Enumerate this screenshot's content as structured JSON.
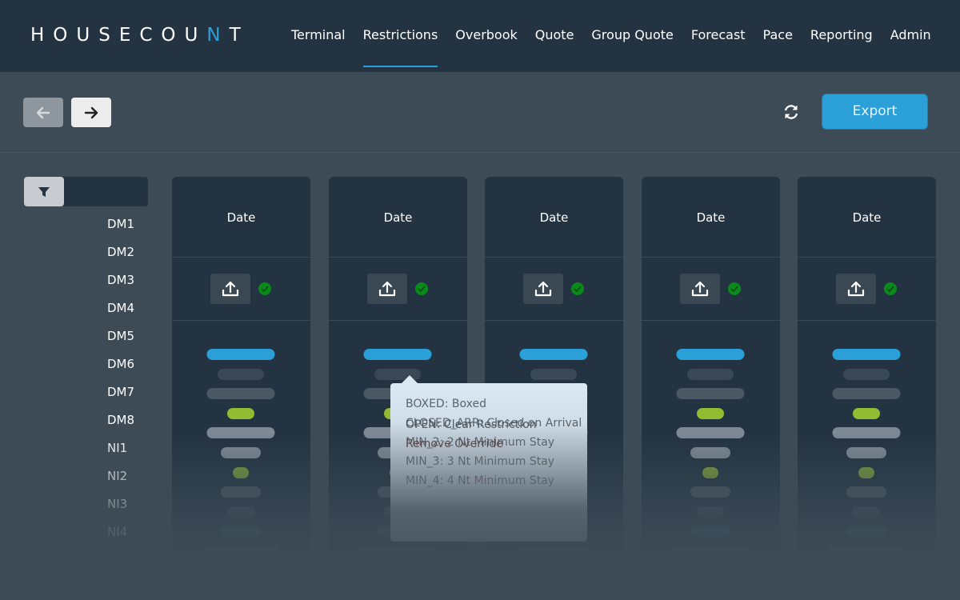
{
  "app": {
    "logo_pre": "HOUSECOU",
    "logo_accent": "N",
    "logo_post": "T"
  },
  "nav": [
    {
      "label": "Terminal"
    },
    {
      "label": "Restrictions",
      "active": true
    },
    {
      "label": "Overbook"
    },
    {
      "label": "Quote"
    },
    {
      "label": "Group Quote"
    },
    {
      "label": "Forecast"
    },
    {
      "label": "Pace"
    },
    {
      "label": "Reporting"
    },
    {
      "label": "Admin"
    }
  ],
  "toolbar": {
    "export_label": "Export",
    "prev_icon": "arrow-left-icon",
    "next_icon": "arrow-right-icon",
    "refresh_icon": "refresh-icon"
  },
  "filter": {
    "icon": "filter-icon"
  },
  "rows": [
    "DM1",
    "DM2",
    "DM3",
    "DM4",
    "DM5",
    "DM6",
    "DM7",
    "DM8",
    "NI1",
    "NI2",
    "NI3",
    "NI4"
  ],
  "columns": [
    {
      "header": "Date",
      "status": "ok"
    },
    {
      "header": "Date",
      "status": "ok"
    },
    {
      "header": "Date",
      "status": "ok"
    },
    {
      "header": "Date",
      "status": "ok"
    },
    {
      "header": "Date",
      "status": "ok"
    }
  ],
  "colors": {
    "accent": "#2a9fd8",
    "ok": "#0a8a1a",
    "green": "#93bc33",
    "bar_dark": "#3a4855",
    "bar_mid": "#4a5863",
    "bar_light": "#7d8a96"
  },
  "dropdown": {
    "items": [
      "BOXED: Boxed",
      "CLOSED_ARR: Closed on Arrival",
      "MIN_2: 2 Nt Minimum Stay",
      "MIN_3: 3 Nt Minimum Stay",
      "MIN_4: 4 Nt Minimum Stay"
    ],
    "open": "OPEN:  Clear Restriction",
    "remove": "Remove Override"
  }
}
